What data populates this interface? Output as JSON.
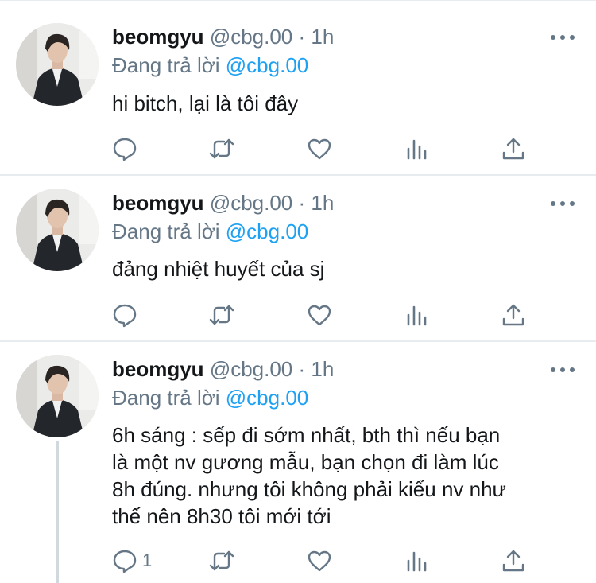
{
  "tweets": [
    {
      "name": "beomgyu",
      "handle": "@cbg.00",
      "sep": " · ",
      "time": "1h",
      "reply_prefix": "Đang trả lời ",
      "reply_handle": "@cbg.00",
      "text": "hi bitch, lại là tôi đây",
      "reply_count": ""
    },
    {
      "name": "beomgyu",
      "handle": "@cbg.00",
      "sep": " · ",
      "time": "1h",
      "reply_prefix": "Đang trả lời ",
      "reply_handle": "@cbg.00",
      "text": "đảng nhiệt huyết của sj",
      "reply_count": ""
    },
    {
      "name": "beomgyu",
      "handle": "@cbg.00",
      "sep": " · ",
      "time": "1h",
      "reply_prefix": "Đang trả lời ",
      "reply_handle": "@cbg.00",
      "text": "6h sáng : sếp đi sớm nhất, bth thì nếu bạn\nlà một nv gương mẫu, bạn chọn đi làm lúc\n8h đúng. nhưng tôi không phải kiểu nv như\nthế nên 8h30 tôi mới tới",
      "reply_count": "1"
    }
  ],
  "icons": {
    "more": "more-horizontal-icon",
    "reply": "reply-bubble-icon",
    "retweet": "retweet-icon",
    "like": "heart-icon",
    "stats": "bar-chart-icon",
    "share": "share-icon"
  },
  "colors": {
    "link": "#1da1f2",
    "muted": "#657786",
    "text": "#14171a",
    "divider": "#e6ecf0"
  }
}
